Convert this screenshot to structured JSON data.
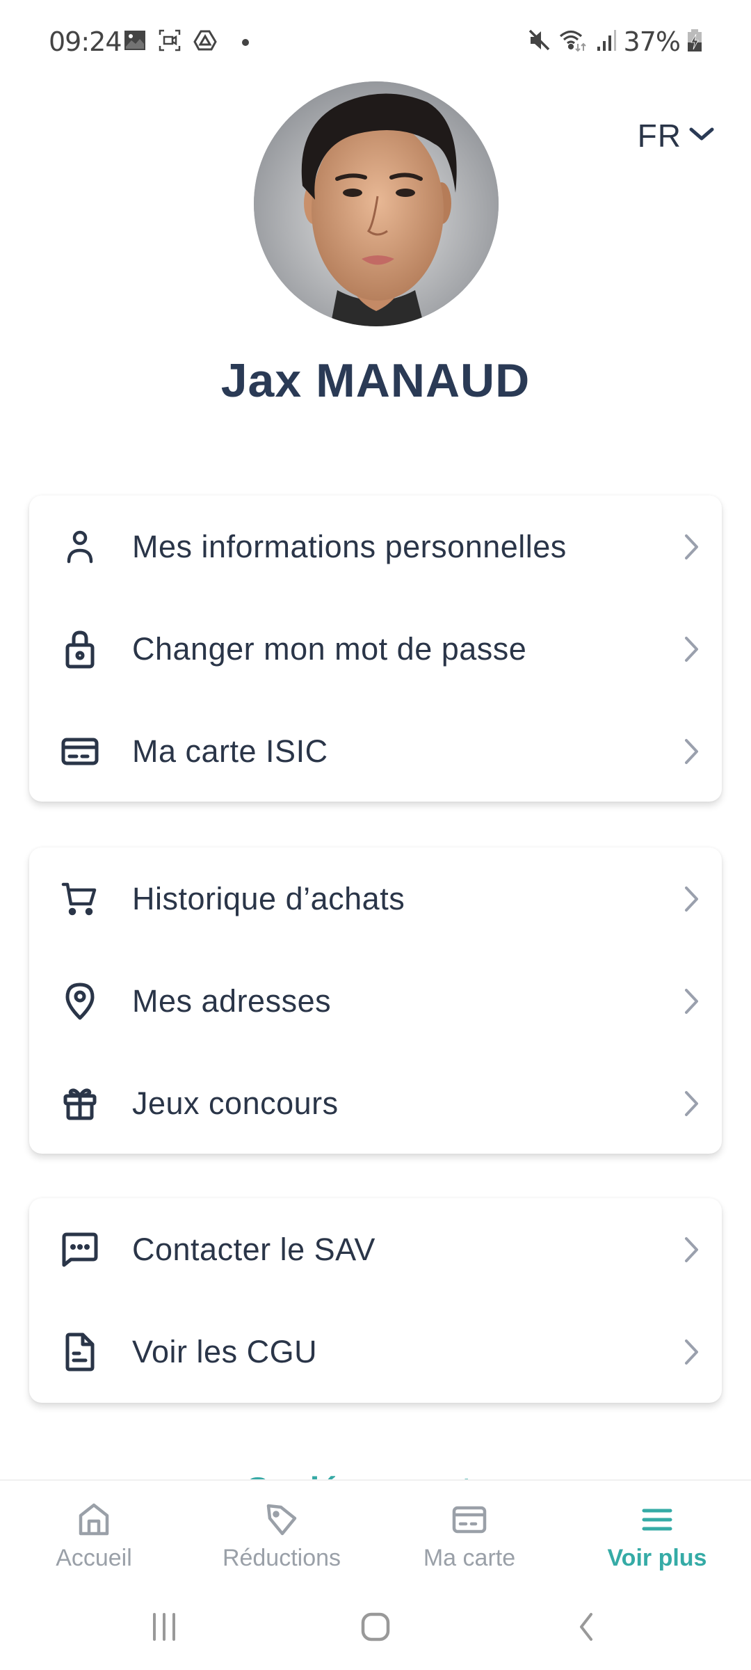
{
  "status_bar": {
    "time": "09:24",
    "left_icons": [
      "gallery-icon",
      "screen-record-icon",
      "drive-icon",
      "notification-dot"
    ],
    "right_icons": [
      "mute-icon",
      "wifi-icon",
      "signal-icon"
    ],
    "battery_percent": "37%",
    "battery_state": "charging"
  },
  "language": {
    "selected": "FR"
  },
  "profile": {
    "name": "Jax MANAUD"
  },
  "menu_groups": [
    {
      "items": [
        {
          "label": "Mes informations personnelles",
          "icon": "user-icon"
        },
        {
          "label": "Changer mon mot de passe",
          "icon": "lock-icon"
        },
        {
          "label": "Ma carte ISIC",
          "icon": "card-icon"
        }
      ]
    },
    {
      "items": [
        {
          "label": "Historique d’achats",
          "icon": "cart-icon"
        },
        {
          "label": "Mes adresses",
          "icon": "location-pin-icon"
        },
        {
          "label": "Jeux concours",
          "icon": "gift-icon"
        }
      ]
    },
    {
      "items": [
        {
          "label": "Contacter le SAV",
          "icon": "chat-icon"
        },
        {
          "label": "Voir les CGU",
          "icon": "document-icon"
        }
      ]
    }
  ],
  "logout_label": "Se déconnecter",
  "bottom_nav": {
    "items": [
      {
        "label": "Accueil",
        "icon": "home-icon",
        "active": false
      },
      {
        "label": "Réductions",
        "icon": "tag-icon",
        "active": false
      },
      {
        "label": "Ma carte",
        "icon": "card-icon",
        "active": false
      },
      {
        "label": "Voir plus",
        "icon": "menu-icon",
        "active": true
      }
    ]
  },
  "colors": {
    "text": "#2a3548",
    "accent": "#35aba6",
    "inactive": "#9aa0a8",
    "chevron": "#9aa0ad"
  }
}
